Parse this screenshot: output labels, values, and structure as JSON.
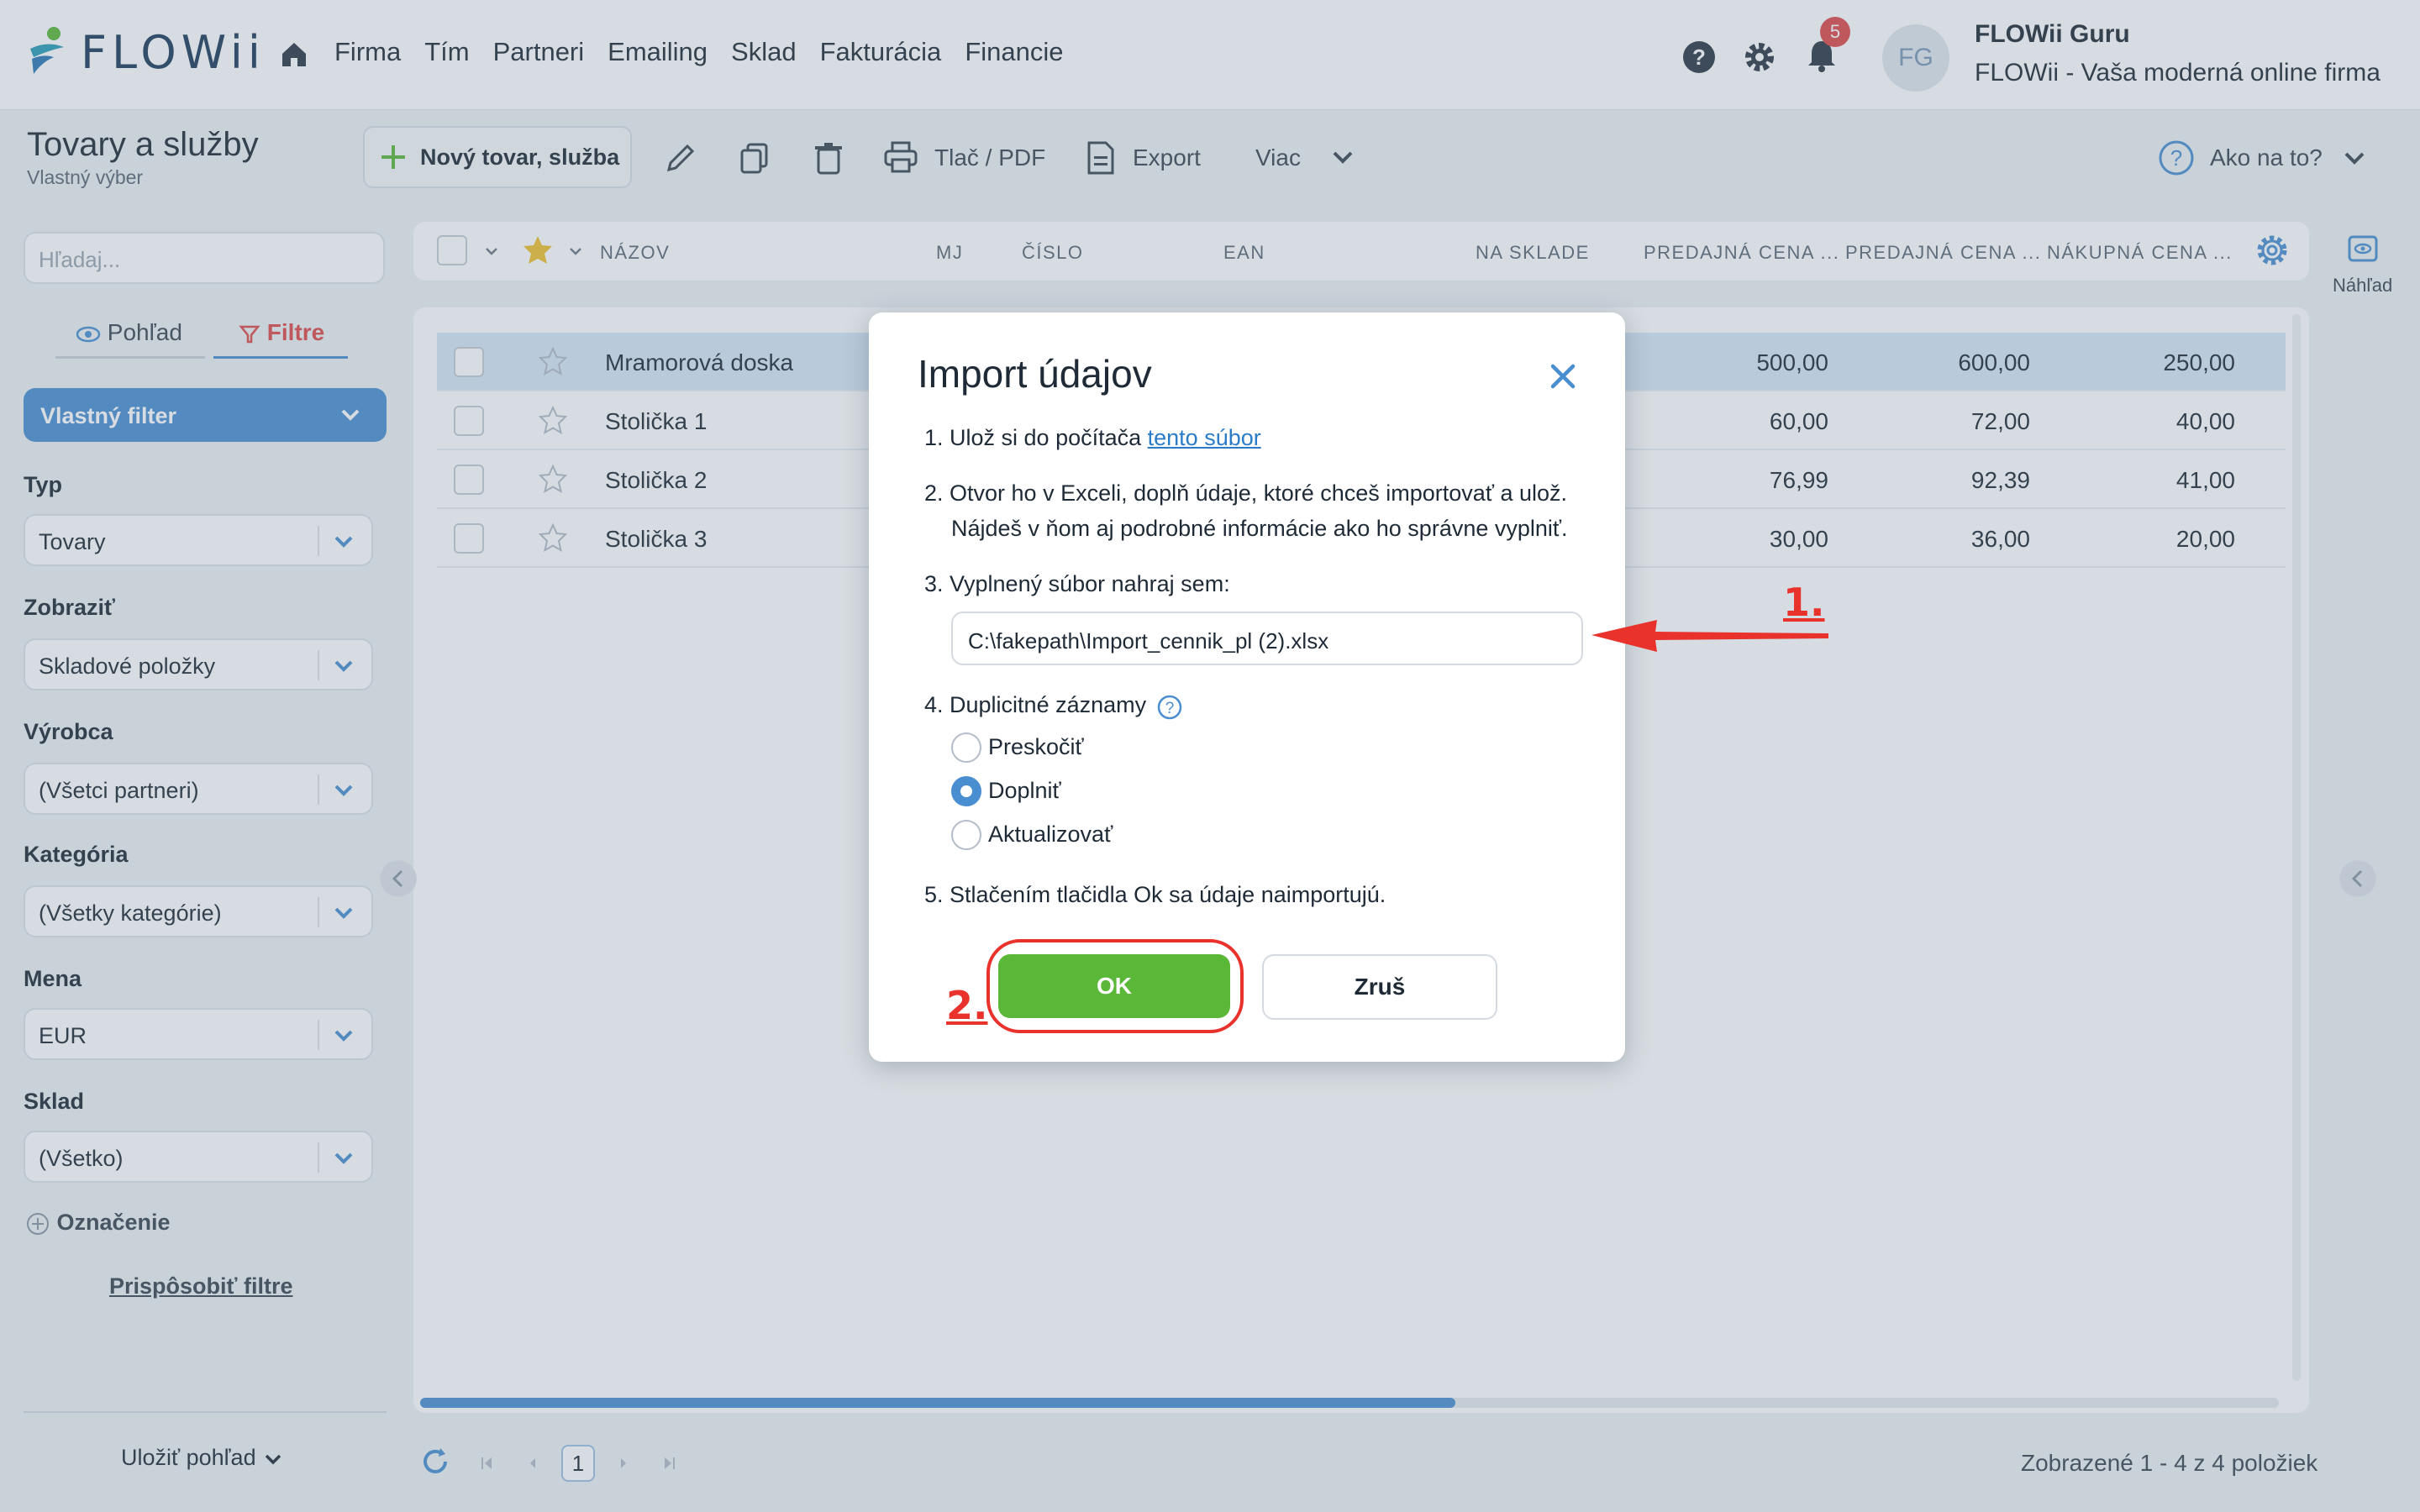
{
  "app": {
    "logo_text": "FLOWii",
    "nav": [
      "Firma",
      "Tím",
      "Partneri",
      "Emailing",
      "Sklad",
      "Fakturácia",
      "Financie"
    ],
    "notifications_count": "5",
    "avatar_initials": "FG",
    "user_name": "FLOWii Guru",
    "user_company": "FLOWii - Vaša moderná online firma"
  },
  "toolbar": {
    "title": "Tovary a služby",
    "subtitle": "Vlastný výber",
    "new_label": "Nový tovar, služba",
    "print_label": "Tlač / PDF",
    "export_label": "Export",
    "more_label": "Viac",
    "howto_label": "Ako na to?"
  },
  "sidebar": {
    "search_placeholder": "Hľadaj...",
    "tab_view": "Pohľad",
    "tab_filters": "Filtre",
    "filter_button": "Vlastný filter",
    "filters": [
      {
        "label": "Typ",
        "value": "Tovary"
      },
      {
        "label": "Zobraziť",
        "value": "Skladové položky"
      },
      {
        "label": "Výrobca",
        "value": "(Všetci partneri)"
      },
      {
        "label": "Kategória",
        "value": "(Všetky kategórie)"
      },
      {
        "label": "Mena",
        "value": "EUR"
      },
      {
        "label": "Sklad",
        "value": "(Všetko)"
      }
    ],
    "tagging_label": "Označenie",
    "customize_label": "Prispôsobiť filtre",
    "save_view_label": "Uložiť pohľad"
  },
  "grid": {
    "columns": [
      "NÁZOV",
      "MJ",
      "ČÍSLO",
      "EAN",
      "NA SKLADE",
      "PREDAJNÁ CENA ...",
      "PREDAJNÁ CENA ...",
      "NÁKUPNÁ CENA ..."
    ],
    "rows": [
      {
        "name": "Mramorová doska",
        "price1": "500,00",
        "price2": "600,00",
        "purchase": "250,00"
      },
      {
        "name": "Stolička 1",
        "price1": "60,00",
        "price2": "72,00",
        "purchase": "40,00"
      },
      {
        "name": "Stolička 2",
        "price1": "76,99",
        "price2": "92,39",
        "purchase": "41,00"
      },
      {
        "name": "Stolička 3",
        "price1": "30,00",
        "price2": "36,00",
        "purchase": "20,00"
      }
    ],
    "page": "1",
    "status": "Zobrazené 1 - 4 z 4 položiek",
    "preview_label": "Náhľad"
  },
  "modal": {
    "title": "Import údajov",
    "step1_prefix": "1. Ulož si do počítača ",
    "step1_link": "tento súbor",
    "step2_line1": "2. Otvor ho v Exceli, doplň údaje, ktoré chceš importovať a ulož.",
    "step2_line2": "Nájdeš v ňom aj podrobné informácie ako ho správne vyplniť.",
    "step3": "3. Vyplnený súbor nahraj sem:",
    "file_value": "C:\\fakepath\\Import_cennik_pl (2).xlsx",
    "step4": "4. Duplicitné záznamy",
    "radio_options": [
      "Preskočiť",
      "Doplniť",
      "Aktualizovať"
    ],
    "radio_selected": "Doplniť",
    "step5": "5. Stlačením tlačidla Ok sa údaje naimportujú.",
    "ok_label": "OK",
    "cancel_label": "Zruš"
  },
  "annotations": {
    "first": "1.",
    "second": "2."
  },
  "colors": {
    "accent": "#4a8ed2",
    "ok_green": "#5ab738",
    "annotation_red": "#e8322b"
  }
}
